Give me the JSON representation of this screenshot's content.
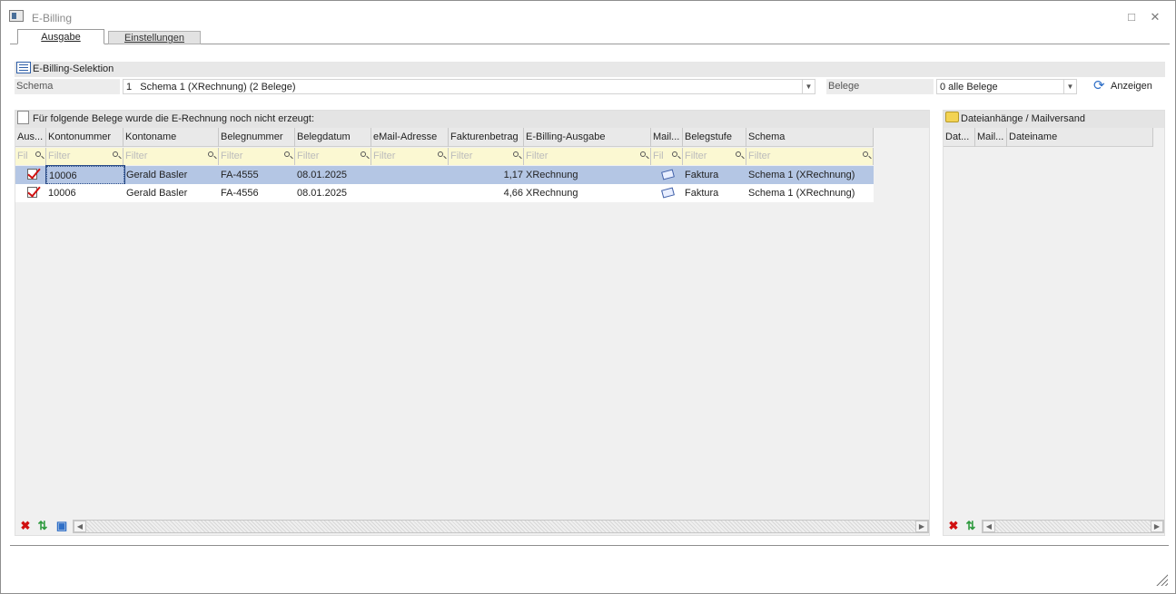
{
  "window": {
    "title": "E-Billing",
    "maximize_glyph": "□",
    "close_glyph": "✕"
  },
  "tabs": [
    {
      "label": "Ausgabe"
    },
    {
      "label": "Einstellungen"
    }
  ],
  "selection": {
    "title": "E-Billing-Selektion",
    "schema_label": "Schema",
    "schema_value": "1   Schema 1 (XRechnung) (2 Belege)",
    "belege_label": "Belege",
    "belege_value": "0 alle Belege",
    "show_button": "Anzeigen"
  },
  "main_grid": {
    "title": "Für folgende Belege wurde die E-Rechnung noch nicht erzeugt:",
    "columns": [
      "Aus...",
      "Kontonummer",
      "Kontoname",
      "Belegnummer",
      "Belegdatum",
      "eMail-Adresse",
      "Fakturenbetrag",
      "E-Billing-Ausgabe",
      "Mail...",
      "Belegstufe",
      "Schema"
    ],
    "filter_placeholder": "Filter",
    "filter_short": "Fil",
    "rows": [
      {
        "selected": true,
        "checked": true,
        "kontonummer": "10006",
        "kontoname": "Gerald Basler",
        "belegnummer": "FA-4555",
        "belegdatum": "08.01.2025",
        "email": "",
        "betrag": "1,17",
        "ausgabe": "XRechnung",
        "mail": "mail-icon",
        "belegstufe": "Faktura",
        "schema": "Schema 1 (XRechnung)"
      },
      {
        "selected": false,
        "checked": true,
        "kontonummer": "10006",
        "kontoname": "Gerald Basler",
        "belegnummer": "FA-4556",
        "belegdatum": "08.01.2025",
        "email": "",
        "betrag": "4,66",
        "ausgabe": "XRechnung",
        "mail": "mail-icon",
        "belegstufe": "Faktura",
        "schema": "Schema 1 (XRechnung)"
      }
    ]
  },
  "attachments": {
    "title": "Dateianhänge / Mailversand",
    "columns": [
      "Dat...",
      "Mail...",
      "Dateiname"
    ]
  },
  "colors": {
    "selected_row": "#b4c6e4",
    "filter_bg": "#fbf8d2",
    "accent": "#2f6fc7",
    "check": "#d01010"
  }
}
